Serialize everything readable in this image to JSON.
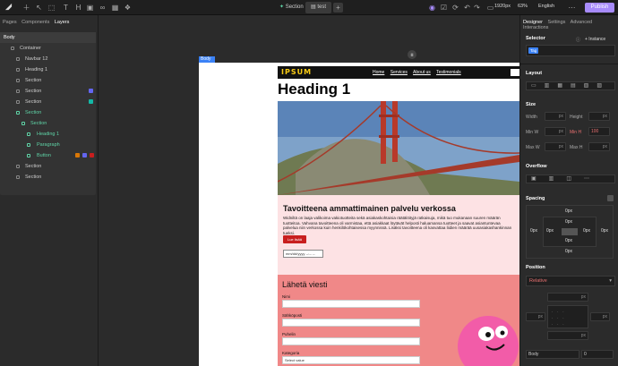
{
  "topbar": {
    "tabs": [
      "Section",
      "test"
    ],
    "breakpoint": "1920px",
    "zoom": "63%",
    "language": "English",
    "publish": "Publish"
  },
  "left": {
    "tabs": [
      "Pages",
      "Components",
      "Layers"
    ],
    "layers": [
      {
        "name": "Body",
        "depth": 0,
        "sel": true,
        "green": false
      },
      {
        "name": "Container",
        "depth": 1,
        "green": false
      },
      {
        "name": "Navbar 12",
        "depth": 2,
        "green": false
      },
      {
        "name": "Heading 1",
        "depth": 2,
        "green": false
      },
      {
        "name": "Section",
        "depth": 2,
        "green": false
      },
      {
        "name": "Section",
        "depth": 2,
        "green": false
      },
      {
        "name": "Section",
        "depth": 2,
        "green": false
      },
      {
        "name": "Section",
        "depth": 2,
        "green": true
      },
      {
        "name": "Section",
        "depth": 3,
        "green": true
      },
      {
        "name": "Heading 1",
        "depth": 4,
        "green": true
      },
      {
        "name": "Paragraph",
        "depth": 4,
        "green": true
      },
      {
        "name": "Button",
        "depth": 4,
        "green": true
      },
      {
        "name": "Section",
        "depth": 2,
        "green": false
      },
      {
        "name": "Section",
        "depth": 2,
        "green": false
      }
    ]
  },
  "right": {
    "tabs": [
      "Designer",
      "Settings",
      "Advanced",
      "Interactions"
    ],
    "selector": "Selector",
    "instance": "+ Instance",
    "tag": "Tag",
    "layout": "Layout",
    "size": "Size",
    "width": "Width",
    "height": "Height",
    "minw": "Min W",
    "minh": "Min H",
    "minh_val": "100",
    "maxw": "Max W",
    "maxh": "Max H",
    "overflow": "Overflow",
    "spacing": "Spacing",
    "position": "Position",
    "position_val": "Relative",
    "px": "px",
    "zero": "0px",
    "body": "Body",
    "z": "0"
  },
  "canvas": {
    "label": "Body",
    "site": {
      "logo": "IPSUM",
      "nav": [
        "Home",
        "Services",
        "About us",
        "Testimonials"
      ],
      "heading": "Heading 1",
      "s1_title": "Tavoitteena ammattimainen palvelu verkossa",
      "s1_text": "Widniltä on laaja valikoima vakiotuotteita sekä asiakaskohtaisia räätälöityjä ratkaisuja, mikä tuo mukanaan suuren määrän tuotteitoa. Vahvana tavoitteena oli varmistaa, että asiakkaat löytävät helposti haluamansa tuotteet ja saavat asiantuntevaa palvelua niin verkossa kuin henkilökohtaisessa myynnissä. Lisäksi tavoitteena oli kasvattaa liidien määrää uusasiakashankinnan tueksi.",
      "s1_btn": "Lue lisää",
      "s1_date": "mm/dd/yyyy  --:-- --",
      "s2_title": "Lähetä viesti",
      "labels": [
        "Nimi",
        "Sähköposti",
        "Puhelin",
        "Kategoria"
      ],
      "select": "Select value"
    }
  }
}
